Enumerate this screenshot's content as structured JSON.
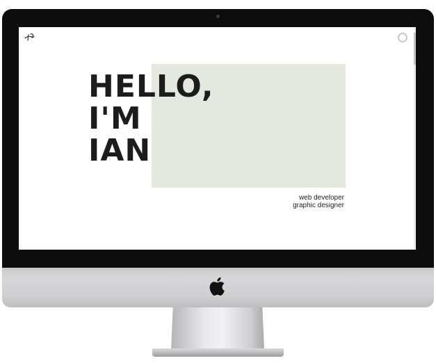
{
  "hero": {
    "line1": "HELLO,",
    "line2": "I'M",
    "line3": "IAN"
  },
  "roles": {
    "role1": "web developer",
    "role2": "graphic designer"
  },
  "colors": {
    "accent_block": "#e4e9e0",
    "heading": "#1c1c1c",
    "bezel": "#0d0d0d"
  },
  "icons": {
    "logo": "signature-logo-icon",
    "menu": "circle-menu-icon",
    "apple": "apple-logo-icon"
  }
}
